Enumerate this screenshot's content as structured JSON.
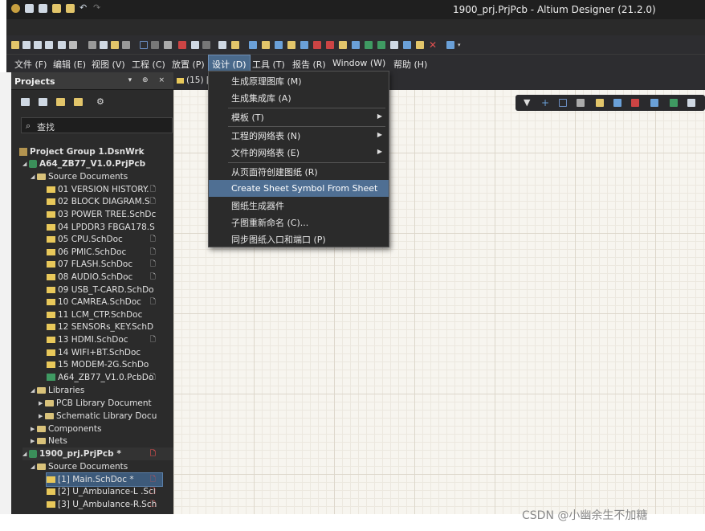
{
  "window": {
    "title": "1900_prj.PrjPcb - Altium Designer (21.2.0)"
  },
  "menubar": {
    "items": [
      {
        "label": "文件 (F)"
      },
      {
        "label": "编辑 (E)"
      },
      {
        "label": "视图 (V)"
      },
      {
        "label": "工程 (C)"
      },
      {
        "label": "放置 (P)"
      },
      {
        "label": "设计 (D)",
        "active": true
      },
      {
        "label": "工具 (T)"
      },
      {
        "label": "报告 (R)"
      },
      {
        "label": "Window (W)"
      },
      {
        "label": "帮助 (H)"
      }
    ]
  },
  "panel": {
    "title": "Projects",
    "controls": "▾ ⊕ ×",
    "search_placeholder": "查找"
  },
  "tree": {
    "group": "Project Group 1.DsnWrk",
    "project1": "A64_ZB77_V1.0.PrjPcb",
    "source_docs": "Source Documents",
    "docs1": [
      "01 VERSION HISTORY.",
      "02 BLOCK DIAGRAM.S",
      "03 POWER TREE.SchDc",
      "04 LPDDR3 FBGA178.S",
      "05 CPU.SchDoc",
      "06 PMIC.SchDoc",
      "07 FLASH.SchDoc",
      "08 AUDIO.SchDoc",
      "09 USB_T-CARD.SchDo",
      "10 CAMREA.SchDoc",
      "11 LCM_CTP.SchDoc",
      "12 SENSORs_KEY.SchD",
      "13 HDMI.SchDoc",
      "14 WIFI+BT.SchDoc",
      "15 MODEM-2G.SchDo"
    ],
    "pcb_doc": "A64_ZB77_V1.0.PcbDo",
    "libraries": "Libraries",
    "pcb_lib": "PCB Library Document",
    "sch_lib": "Schematic Library Docu",
    "components": "Components",
    "nets": "Nets",
    "project2": "1900_prj.PrjPcb *",
    "source_docs2": "Source Documents",
    "docs2": [
      "[1] Main.SchDoc *",
      "[2] U_Ambulance-L .Scl",
      "[3] U_Ambulance-R.Sch"
    ]
  },
  "doc_tab": {
    "label": "(15) ["
  },
  "dropdown": {
    "items": [
      {
        "label": "生成原理图库 (M)"
      },
      {
        "label": "生成集成库 (A)"
      },
      {
        "label": "模板 (T)",
        "submenu": true
      },
      {
        "label": "工程的网络表 (N)",
        "submenu": true
      },
      {
        "label": "文件的网络表 (E)",
        "submenu": true
      },
      {
        "label": "从页面符创建图纸 (R)"
      },
      {
        "label": "Create Sheet Symbol From Sheet",
        "highlighted": true
      },
      {
        "label": "图纸生成器件"
      },
      {
        "label": "子图重新命名 (C)..."
      },
      {
        "label": "同步图纸入口和端口 (P)"
      }
    ]
  },
  "watermark": "CSDN @小幽余生不加糖",
  "colors": {
    "menu_bg": "#2d2d30",
    "highlight": "#4f6f93",
    "sheet_bg": "#f7f5ef"
  }
}
